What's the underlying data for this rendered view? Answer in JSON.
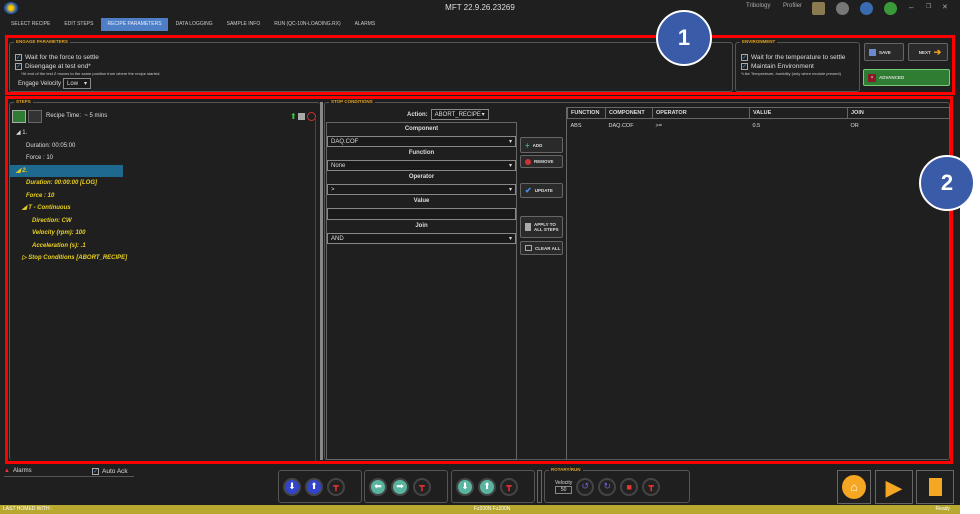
{
  "app": {
    "title": "MFT 22.9.26.23269",
    "right_links": [
      "Tribology",
      "Profiler"
    ]
  },
  "tabs": [
    "SELECT RECIPE",
    "EDIT STEPS",
    "RECIPE PARAMETERS",
    "DATA LOGGING",
    "SAMPLE INFO",
    "RUN (QC-10N-LOADING.RX)",
    "ALARMS"
  ],
  "engage": {
    "title": "ENGAGE PARAMETERS",
    "wait_force": "Wait for the force to settle",
    "disengage": "Disengage at test end*",
    "note": "*At end of the test Z moves to the same position from where the recipe started.",
    "velocity_label": "Engage Velocity",
    "velocity_value": "Low"
  },
  "environment": {
    "title": "ENVIRONMENT",
    "wait_temp": "Wait for the temperature to settle",
    "maintain": "Maintain Environment",
    "note": "*Like Temperature, humidity (only when module present)"
  },
  "actions": {
    "save": "SAVE",
    "next": "NEXT",
    "advanced": "ADVANCED"
  },
  "steps": {
    "title": "STEPS",
    "recipe_time_label": "Recipe Time:",
    "recipe_time": "~ 5 mins",
    "tree": [
      "1.",
      "Duration: 00:05:00",
      "Force : 10",
      "2.",
      "Duration: 00:00:00 [LOG]",
      "Force : 10",
      "T - Continuous",
      "Direction: CW",
      "Velocity (rpm): 100",
      "Acceleration (s): .1",
      "Stop Conditions [ABORT_RECIPE]"
    ]
  },
  "stop": {
    "title": "STOP CONDITIONS",
    "action_label": "Action:",
    "action_value": "ABORT_RECIPE",
    "component_label": "Component",
    "component_value": "DAQ.COF",
    "function_label": "Function",
    "function_value": "None",
    "operator_label": "Operator",
    "operator_value": ">",
    "value_label": "Value",
    "value_value": "",
    "join_label": "Join",
    "join_value": "AND",
    "buttons": {
      "add": "ADD",
      "remove": "REMOVE",
      "update": "UPDATE",
      "apply1": "APPLY TO",
      "apply2": "ALL STEPS",
      "clear": "CLEAR ALL"
    }
  },
  "table": {
    "headers": [
      "FUNCTION",
      "COMPONENT",
      "OPERATOR",
      "VALUE",
      "JOIN"
    ],
    "rows": [
      [
        "ABS",
        "DAQ.COF",
        ">=",
        "0.5",
        "OR"
      ]
    ]
  },
  "bottom": {
    "alarms": "Alarms",
    "auto_ack": "Auto Ack",
    "rotary_title": "ROTARY/RUN",
    "velocity_label": "Velocity",
    "velocity_value": "50"
  },
  "status": {
    "left": "LAST HOMED WITH :",
    "center": "Fz200N Fz200N",
    "right": "Ready"
  },
  "annotations": [
    "1",
    "2"
  ],
  "colors": {
    "accent": "#4e7ec5",
    "highlight": "#1d6a8e",
    "step_text": "#e8d020",
    "advanced": "#2e7d32",
    "orange": "#f5a623"
  }
}
